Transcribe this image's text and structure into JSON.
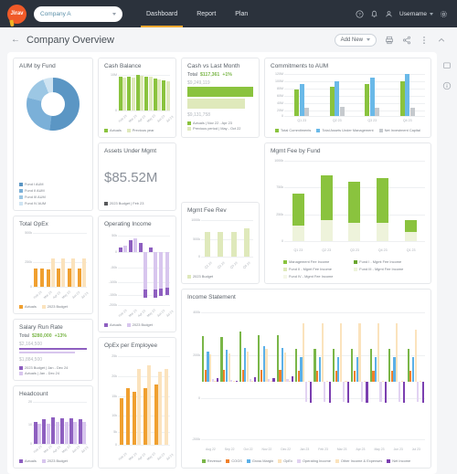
{
  "nav": {
    "logo_text": "Jirav",
    "company": "Company A",
    "links": [
      "Dashboard",
      "Report",
      "Plan"
    ],
    "active_link": "Dashboard",
    "username": "Username",
    "icons": [
      "help-icon",
      "bell-icon",
      "person-icon",
      "gear-icon"
    ]
  },
  "subheader": {
    "back": "←",
    "title": "Company Overview",
    "add_new": "Add New",
    "print_icon": "printer-icon",
    "share_icon": "share-icon",
    "more_icon": "more-vertical-icon",
    "collapse_icon": "chevron-up-icon"
  },
  "rail": {
    "icons": [
      "comment-icon",
      "info-icon"
    ]
  },
  "colors": {
    "green": "#8ac33e",
    "green_light": "#dfe9bb",
    "green_pale": "#eef3db",
    "blue": "#6ab9e8",
    "blue_dark": "#5b96c4",
    "blue_mid": "#7bb0d8",
    "blue_pale": "#cfe4f2",
    "gray": "#c6cace",
    "orange": "#f0a030",
    "orange_light": "#fbe3bd",
    "purple": "#8e5fc0",
    "purple_light": "#d8c6ee",
    "accent_orange": "#f0a830"
  },
  "cards": {
    "aum_by_fund": {
      "title": "AUM by Fund",
      "chart_data": {
        "type": "pie",
        "title": "AUM by Fund",
        "labels": [
          "Fund I AUM",
          "Fund II AUM",
          "Fund III AUM",
          "Fund IV AUM"
        ],
        "values": [
          52,
          27,
          15,
          6
        ],
        "colors": [
          "#5b96c4",
          "#7bb0d8",
          "#9cc7e4",
          "#cfe4f2"
        ],
        "legend": "bottom-left"
      }
    },
    "cash_balance": {
      "title": "Cash Balance",
      "chart_data": {
        "type": "bar",
        "title": "Cash Balance",
        "categories": [
          "Feb 23",
          "Mar 23",
          "Apr 23",
          "May 23",
          "Jun 23",
          "Jul 23"
        ],
        "series": [
          {
            "name": "Actuals",
            "values": [
              9.1,
              9.1,
              9.3,
              9.2,
              8.9,
              8.6
            ],
            "color": "#8ac33e"
          },
          {
            "name": "Previous year",
            "values": [
              8.9,
              8.9,
              9.1,
              9.0,
              8.7,
              8.4
            ],
            "color": "#dfe9bb"
          }
        ],
        "ylim": [
          0,
          10
        ],
        "yticks": [
          "0",
          "10M"
        ],
        "ylabel": "",
        "xlabel": "",
        "grid": true
      }
    },
    "cash_vs_last_month": {
      "title": "Cash vs Last Month",
      "total_label": "Total",
      "total_value": "$117,361",
      "total_delta": "+1%",
      "top_number": "$9,249,119",
      "bottom_number": "$9,131,758",
      "chart_data": {
        "type": "bar",
        "orientation": "horizontal",
        "title": "Cash vs Last Month",
        "categories": [
          "Actuals | Nov 22 - Apr 23",
          "Previous period | May - Oct 22"
        ],
        "values": [
          9249119,
          9131758
        ],
        "colors": [
          "#8ac33e",
          "#dfe9bb"
        ]
      },
      "legend": [
        "Actuals | Nov 22 - Apr 23",
        "Previous period | May - Oct 22"
      ]
    },
    "commitments_to_aum": {
      "title": "Commitments to AUM",
      "chart_data": {
        "type": "bar",
        "title": "Commitments to AUM",
        "categories": [
          "Q1 23",
          "Q2 23",
          "Q3 23",
          "Q4 23"
        ],
        "series": [
          {
            "name": "Total Commitments",
            "values": [
              73,
              79,
              86,
              95
            ],
            "color": "#8ac33e"
          },
          {
            "name": "Total Assets Under Management",
            "values": [
              88,
              96,
              105,
              114
            ],
            "color": "#6ab9e8"
          },
          {
            "name": "Net Investment Capital",
            "values": [
              23,
              25,
              24,
              23
            ],
            "color": "#c6cace"
          }
        ],
        "ylim": [
          0,
          120
        ],
        "yticks": [
          "0",
          "20M",
          "40M",
          "60M",
          "80M",
          "100M",
          "120M"
        ],
        "ylabel": "",
        "xlabel": "",
        "grid": true
      }
    },
    "assets_under_mgmt": {
      "title": "Assets Under Mgmt",
      "value": "$85.52M",
      "legend": [
        "2023 Budget | Feb 23"
      ],
      "chart_data": {
        "type": "table",
        "title": "Assets Under Mgmt",
        "values": [
          85.52
        ],
        "labels": [
          "2023 Budget | Feb 23"
        ]
      }
    },
    "operating_income": {
      "title": "Operating Income",
      "chart_data": {
        "type": "bar",
        "title": "Operating Income",
        "categories": [
          "Feb 23",
          "Mar 23",
          "Apr 23",
          "May 23",
          "Jun 23",
          "Jul 23"
        ],
        "series": [
          {
            "name": "Actuals",
            "values": [
              8,
              28,
              -142,
              -140,
              -132,
              -128
            ],
            "color": "#8e5fc0"
          },
          {
            "name": "2023 Budget",
            "values": [
              10,
              30,
              22,
              8,
              2,
              2
            ],
            "color": "#d8c6ee"
          }
        ],
        "ylim": [
          -200,
          50
        ],
        "yticks": [
          "50k",
          "0",
          "-50k",
          "-100k",
          "-150k",
          "-200k"
        ],
        "grid": true
      }
    },
    "total_opex": {
      "title": "Total OpEx",
      "chart_data": {
        "type": "bar",
        "title": "Total OpEx",
        "categories": [
          "Feb 23",
          "Mar 23",
          "Apr 23",
          "May 23",
          "Jun 23",
          "Jul 23"
        ],
        "series": [
          {
            "name": "Actuals",
            "values": [
              160,
              160,
              155,
              160,
              160,
              160
            ],
            "color": "#f0a030"
          },
          {
            "name": "2023 Budget",
            "values": [
              0,
              0,
              250,
              250,
              250,
              250
            ],
            "color": "#fbe3bd"
          }
        ],
        "ylim": [
          0,
          500
        ],
        "yticks": [
          "0",
          "250k",
          "500k"
        ],
        "grid": true
      }
    },
    "opex_per_employee": {
      "title": "OpEx per Employee",
      "chart_data": {
        "type": "bar",
        "title": "OpEx per Employee",
        "categories": [
          "Feb 23",
          "Mar 23",
          "Apr 23",
          "May 23",
          "Jun 23",
          "Jul 23"
        ],
        "series": [
          {
            "name": "Actuals",
            "values": [
              12.5,
              15.2,
              14.3,
              15.3,
              16.3,
              0
            ],
            "color": "#f0a030"
          },
          {
            "name": "2023 Budget",
            "values": [
              0,
              0,
              20.2,
              21.2,
              19.8,
              20.2
            ],
            "color": "#fbe3bd"
          }
        ],
        "ylim": [
          0,
          25
        ],
        "yticks": [
          "0",
          "5k",
          "10k",
          "15k",
          "20k",
          "25k"
        ],
        "grid": true
      }
    },
    "mgmt_fee_rev": {
      "title": "Mgmt Fee Rev",
      "chart_data": {
        "type": "bar",
        "title": "Mgmt Fee Rev",
        "categories": [
          "Q1 23",
          "Q2 23",
          "Q3 23",
          "Q4 23"
        ],
        "series": [
          {
            "name": "2023 Budget",
            "values": [
              660,
              660,
              660,
              760
            ],
            "color": "#dfe9bb"
          }
        ],
        "ylim": [
          0,
          1000
        ],
        "yticks": [
          "0",
          "500k",
          "1000k"
        ],
        "grid": true
      }
    },
    "mgmt_fee_by_fund": {
      "title": "Mgmt Fee by Fund",
      "chart_data": {
        "type": "bar",
        "stacked": true,
        "title": "Mgmt Fee by Fund",
        "categories": [
          "Q1 23",
          "Q2 23",
          "Q3 23",
          "Q4 23",
          "Q1 23"
        ],
        "series": [
          {
            "name": "Fund II - Mgmt Fee Income",
            "values": [
              185,
              240,
              215,
              215,
              105
            ],
            "color": "#eef3db"
          },
          {
            "name": "Management Fee Income",
            "values": [
              370,
              545,
              490,
              530,
              140
            ],
            "color": "#8ac33e"
          }
        ],
        "ylim": [
          0,
          1000
        ],
        "yticks": [
          "0",
          "250k",
          "750k",
          "1000k"
        ],
        "grid": true
      },
      "legend": [
        "Management Fee Income",
        "Fund I - Mgmt Fee Income",
        "Fund II - Mgmt Fee Income",
        "Fund III - Mgmt Fee Income",
        "Fund IV - Mgmt Fee Income"
      ]
    },
    "salary_run_rate": {
      "title": "Salary Run Rate",
      "total_label": "Total",
      "total_value": "$280,000",
      "total_delta": "+13%",
      "top_number": "$2,164,500",
      "bottom_number": "$1,884,500",
      "legend": [
        "2023 Budget | Jan - Dec 24",
        "Actuals | Jan - Dec 24"
      ],
      "chart_data": {
        "type": "bar",
        "orientation": "horizontal",
        "title": "Salary Run Rate",
        "categories": [
          "2023 Budget | Jan - Dec 24",
          "Actuals | Jan - Dec 24"
        ],
        "values": [
          2164500,
          1884500
        ],
        "colors": [
          "#8e5fc0",
          "#d8c6ee"
        ]
      }
    },
    "headcount": {
      "title": "Headcount",
      "chart_data": {
        "type": "bar",
        "title": "Headcount",
        "categories": [
          "Feb 23",
          "Mar 23",
          "Apr 23",
          "May 23",
          "Jun 23",
          "Jul 23"
        ],
        "series": [
          {
            "name": "Actuals",
            "values": [
              13,
              14,
              15,
              15,
              15,
              14
            ],
            "color": "#8e5fc0"
          },
          {
            "name": "2023 Budget",
            "values": [
              12,
              12,
              13,
              13,
              13,
              13
            ],
            "color": "#d8c6ee"
          }
        ],
        "ylim": [
          0,
          20
        ],
        "yticks": [
          "0",
          "10",
          "20"
        ],
        "grid": true
      }
    },
    "income_statement": {
      "title": "Income Statement",
      "chart_data": {
        "type": "bar",
        "title": "Income Statement",
        "categories": [
          "Aug 22",
          "Sep 22",
          "Oct 22",
          "Nov 22",
          "Dec 22",
          "Jan 23",
          "Feb 23",
          "Mar 23",
          "Apr 23",
          "May 23",
          "Jun 23",
          "Jul 23"
        ],
        "series": [
          {
            "name": "Revenue",
            "values": [
              278,
              272,
              307,
              282,
              281,
              198,
              198,
              198,
              198,
              198,
              198,
              198
            ],
            "color": "#7ab648"
          },
          {
            "name": "COGS",
            "values": [
              68,
              68,
              68,
              68,
              68,
              66,
              66,
              66,
              66,
              66,
              66,
              66
            ],
            "color": "#f0802a"
          },
          {
            "name": "Gross Margin",
            "values": [
              182,
              190,
              203,
              210,
              202,
              148,
              148,
              148,
              148,
              148,
              148,
              148
            ],
            "color": "#5bb0e8"
          },
          {
            "name": "OpEx",
            "values": [
              168,
              170,
              180,
              194,
              175,
              348,
              348,
              348,
              348,
              348,
              348,
              310
            ],
            "color": "#fbe3bd"
          },
          {
            "name": "Operating Income",
            "values": [
              12,
              10,
              14,
              12,
              14,
              -148,
              -148,
              -148,
              -148,
              -148,
              -148,
              -148
            ],
            "color": "#e2d3f2"
          },
          {
            "name": "Other Income & Expenses",
            "values": [
              4,
              2,
              6,
              4,
              6,
              2,
              2,
              2,
              2,
              2,
              2,
              2
            ],
            "color": "#fbe3bd"
          },
          {
            "name": "Net Income",
            "values": [
              14,
              2,
              18,
              16,
              22,
              -150,
              -150,
              -150,
              -150,
              -150,
              -150,
              -150
            ],
            "color": "#7b3fb0"
          }
        ],
        "ylim": [
          -200,
          400
        ],
        "yticks": [
          "400k",
          "200k",
          "0",
          "-200k"
        ],
        "grid": true
      }
    }
  }
}
